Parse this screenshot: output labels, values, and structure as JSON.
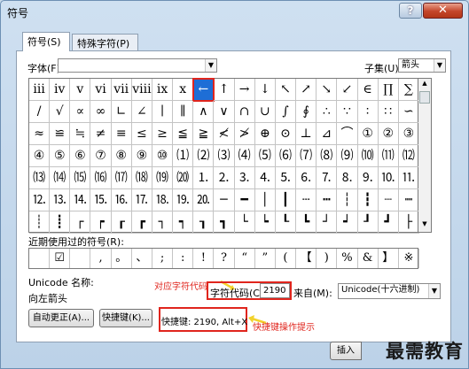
{
  "window": {
    "title": "符号",
    "help_label": "?",
    "close_label": "✕"
  },
  "tabs": [
    {
      "label": "符号(S)"
    },
    {
      "label": "特殊字符(P)"
    }
  ],
  "font": {
    "label": "字体(F):",
    "value": ""
  },
  "subset": {
    "label": "子集(U):",
    "value": "箭头"
  },
  "grid_rows": [
    [
      "ⅲ",
      "ⅳ",
      "ⅴ",
      "ⅵ",
      "ⅶ",
      "ⅷ",
      "ⅸ",
      "ⅹ",
      "←",
      "↑",
      "→",
      "↓",
      "↖",
      "↗",
      "↘",
      "↙",
      "∈",
      "∏",
      "∑"
    ],
    [
      "/",
      "√",
      "∝",
      "∞",
      "∟",
      "∠",
      "∣",
      "∥",
      "∧",
      "∨",
      "∩",
      "∪",
      "∫",
      "∮",
      "∴",
      "∵",
      "∶",
      "∷",
      "∽"
    ],
    [
      "≈",
      "≌",
      "≒",
      "≠",
      "≡",
      "≤",
      "≥",
      "≦",
      "≧",
      "≮",
      "≯",
      "⊕",
      "⊙",
      "⊥",
      "⊿",
      "⌒",
      "①",
      "②",
      "③"
    ],
    [
      "④",
      "⑤",
      "⑥",
      "⑦",
      "⑧",
      "⑨",
      "⑩",
      "⑴",
      "⑵",
      "⑶",
      "⑷",
      "⑸",
      "⑹",
      "⑺",
      "⑻",
      "⑼",
      "⑽",
      "⑾",
      "⑿"
    ],
    [
      "⒀",
      "⒁",
      "⒂",
      "⒃",
      "⒄",
      "⒅",
      "⒆",
      "⒇",
      "⒈",
      "⒉",
      "⒊",
      "⒋",
      "⒌",
      "⒍",
      "⒎",
      "⒏",
      "⒐",
      "⒑",
      "⒒"
    ],
    [
      "⒓",
      "⒔",
      "⒕",
      "⒖",
      "⒗",
      "⒘",
      "⒙",
      "⒚",
      "⒛",
      "─",
      "━",
      "│",
      "┃",
      "┄",
      "┅",
      "┆",
      "┇",
      "┈",
      "┉"
    ],
    [
      "┊",
      "┋",
      "┌",
      "┍",
      "┎",
      "┏",
      "┐",
      "┑",
      "┒",
      "┓",
      "└",
      "┕",
      "┖",
      "┗",
      "┘",
      "┙",
      "┚",
      "┛",
      "├"
    ]
  ],
  "recent": {
    "label": "近期使用过的符号(R):",
    "symbols": [
      "",
      "☑",
      "",
      ",",
      "。",
      "、",
      ";",
      ":",
      "!",
      "?",
      "“",
      "”",
      "(",
      "【",
      ")",
      "%",
      "&",
      "】",
      "※"
    ]
  },
  "unicode": {
    "name_label": "Unicode 名称:",
    "name_value": "向左箭头"
  },
  "code": {
    "label": "字符代码(C):",
    "value": "2190",
    "from_label": "来自(M):",
    "from_value": "Unicode(十六进制)"
  },
  "buttons": {
    "autocorrect": "自动更正(A)...",
    "shortcut": "快捷键(K)...",
    "insert": "插入"
  },
  "shortcut_info": "快捷键: 2190, Alt+X",
  "annotations": {
    "code_note": "对应字符代码",
    "shortcut_note": "快捷键操作提示"
  },
  "watermark": "最需教育",
  "colors": {
    "annotation": "#e0251d",
    "arrow": "#f2d22b",
    "selected": "#1e6ed6"
  }
}
